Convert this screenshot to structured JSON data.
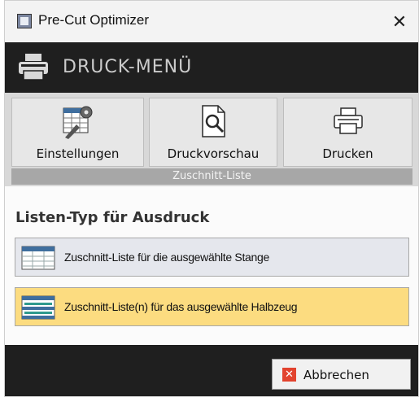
{
  "window": {
    "title": "Pre-Cut Optimizer",
    "close_glyph": "✕"
  },
  "header": {
    "title": "DRUCK-MENÜ",
    "icon": "printer-icon"
  },
  "toolbar": {
    "buttons": [
      {
        "label": "Einstellungen",
        "icon": "settings-grid-icon"
      },
      {
        "label": "Druckvorschau",
        "icon": "print-preview-icon"
      },
      {
        "label": "Drucken",
        "icon": "printer-icon"
      }
    ],
    "group_label": "Zuschnitt-Liste"
  },
  "section": {
    "title": "Listen-Typ für Ausdruck"
  },
  "options": [
    {
      "label": "Zuschnitt-Liste für die ausgewählte Stange",
      "icon": "list-table-icon",
      "selected": false
    },
    {
      "label": "Zuschnitt-Liste(n) für das ausgewählte Halbzeug",
      "icon": "multi-list-table-icon",
      "selected": true
    }
  ],
  "footer": {
    "cancel_label": "Abbrechen",
    "cancel_glyph": "✕"
  },
  "colors": {
    "header_bg": "#1f1f1f",
    "selected_bg": "#fcdc80",
    "cancel_icon": "#e2432e"
  }
}
